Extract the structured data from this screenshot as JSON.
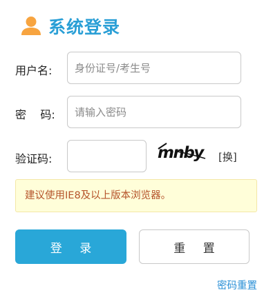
{
  "header": {
    "title": "系统登录",
    "icon": "user-icon",
    "icon_color": "#f7a440"
  },
  "form": {
    "username": {
      "label": "用户名:",
      "placeholder": "身份证号/考生号",
      "value": ""
    },
    "password": {
      "label": "密    码:",
      "placeholder": "请输入密码",
      "value": ""
    },
    "captcha": {
      "label": "验证码:",
      "value": "",
      "image_text": "mnby",
      "refresh_label": "[换]"
    }
  },
  "notice": {
    "text": "建议使用IE8及以上版本浏览器。",
    "bg_color": "#fffed9",
    "text_color": "#b5532a"
  },
  "buttons": {
    "login_label": "登 录",
    "reset_label": "重 置",
    "login_color": "#29a7d8"
  },
  "links": {
    "password_reset": "密码重置"
  },
  "colors": {
    "accent": "#2a9fd6",
    "link": "#2a8fd6"
  }
}
